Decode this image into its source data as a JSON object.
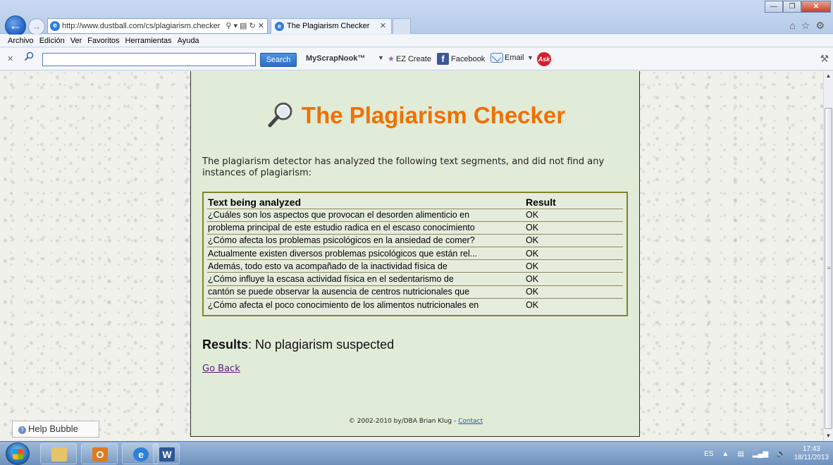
{
  "browser": {
    "url": "http://www.dustball.com/cs/plagiarism.checker",
    "tab_title": "The Plagiarism Checker",
    "menu": [
      "Archivo",
      "Edición",
      "Ver",
      "Favoritos",
      "Herramientas",
      "Ayuda"
    ],
    "toolbar": {
      "search_button": "Search",
      "search_value": "",
      "brand": "MyScrapNook™",
      "ez_create": "EZ Create",
      "facebook": "Facebook",
      "email": "Email",
      "ask": "Ask"
    }
  },
  "page": {
    "title": "The Plagiarism Checker",
    "intro": "The plagiarism detector has analyzed the following text segments, and did not find any instances of plagiarism:",
    "table": {
      "headers": [
        "Text being analyzed",
        "Result"
      ],
      "rows": [
        {
          "text": "¿Cuáles son los aspectos que provocan el desorden alimenticio en",
          "result": "OK"
        },
        {
          "text": "problema principal de este estudio radica en el escaso conocimiento",
          "result": "OK"
        },
        {
          "text": "¿Cómo afecta los problemas psicológicos en la ansiedad de comer?",
          "result": "OK"
        },
        {
          "text": "Actualmente existen diversos problemas psicológicos que están rel...",
          "result": "OK"
        },
        {
          "text": "Además, todo esto va acompañado de la inactividad física de",
          "result": "OK"
        },
        {
          "text": "¿Cómo influye la escasa actividad física en el sedentarismo de",
          "result": "OK"
        },
        {
          "text": "cantón se puede observar la ausencia de centros nutricionales que",
          "result": "OK"
        },
        {
          "text": "¿Cómo afecta el poco conocimiento de los alimentos nutricionales en",
          "result": "OK"
        }
      ]
    },
    "results_label": "Results",
    "results_value": ": No plagiarism suspected",
    "go_back": "Go Back",
    "footer_text": "© 2002-2010 by/DBA Brian Klug - ",
    "footer_link": "Contact"
  },
  "help_bubble": "Help Bubble",
  "taskbar": {
    "language": "ES",
    "time": "17:43",
    "date": "18/11/2013"
  }
}
